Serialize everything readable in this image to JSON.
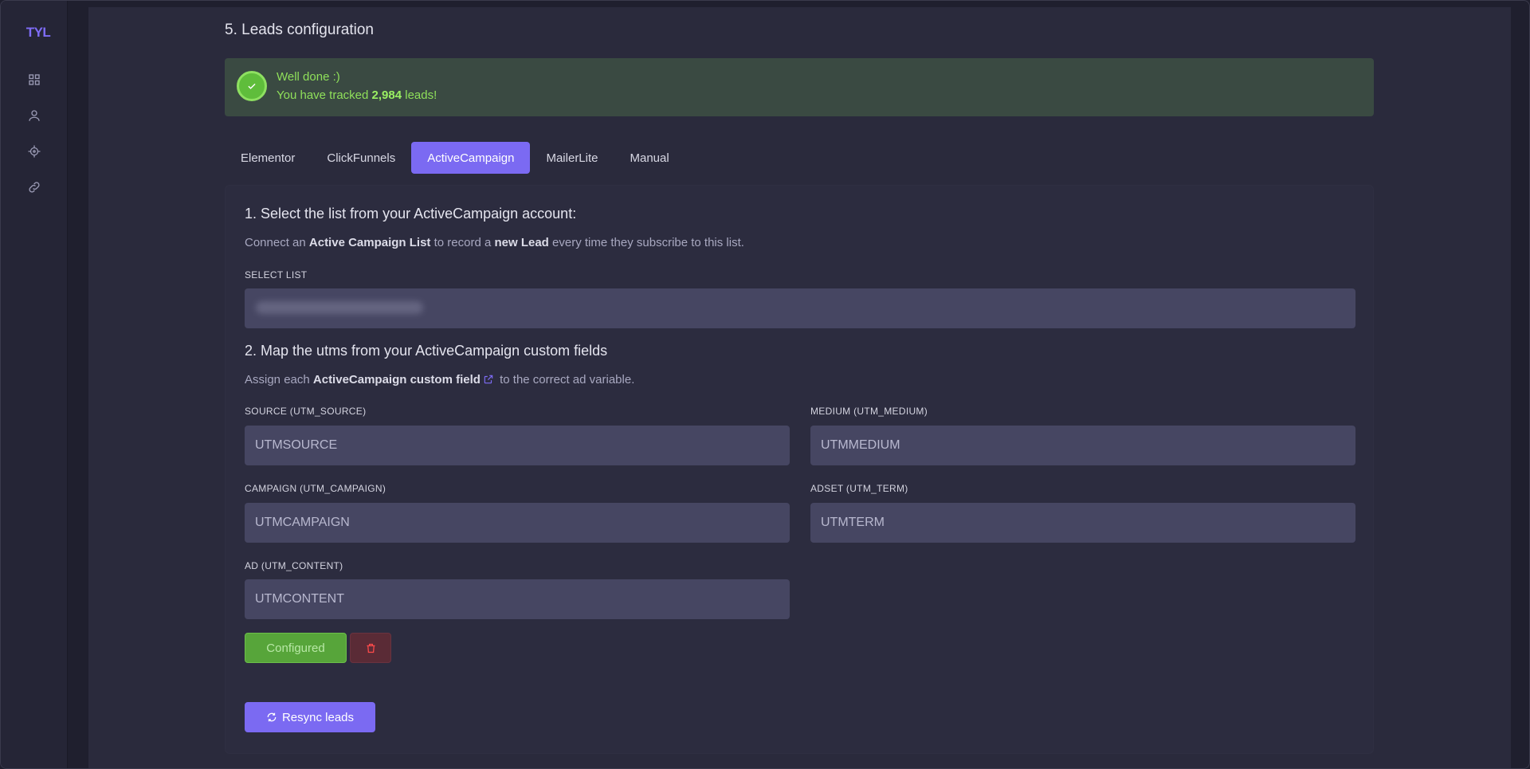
{
  "app": {
    "logo": "TYL"
  },
  "sidebar": {
    "items": [
      {
        "icon": "grid-icon"
      },
      {
        "icon": "user-icon"
      },
      {
        "icon": "target-icon"
      },
      {
        "icon": "link-icon"
      }
    ]
  },
  "section": {
    "title": "5. Leads configuration"
  },
  "alert": {
    "title": "Well done :)",
    "text_prefix": "You have tracked ",
    "count": "2,984",
    "text_suffix": " leads!"
  },
  "tabs": [
    {
      "label": "Elementor",
      "active": false
    },
    {
      "label": "ClickFunnels",
      "active": false
    },
    {
      "label": "ActiveCampaign",
      "active": true
    },
    {
      "label": "MailerLite",
      "active": false
    },
    {
      "label": "Manual",
      "active": false
    }
  ],
  "step1": {
    "heading": "1. Select the list from your ActiveCampaign account:",
    "desc_1": "Connect an ",
    "desc_b1": "Active Campaign List",
    "desc_2": " to record a ",
    "desc_b2": "new Lead",
    "desc_3": " every time they subscribe to this list.",
    "select_label": "SELECT LIST"
  },
  "step2": {
    "heading": "2. Map the utms from your ActiveCampaign custom fields",
    "desc_1": "Assign each ",
    "desc_b1": "ActiveCampaign custom field",
    "desc_2": " to the correct ad variable.",
    "fields": {
      "source": {
        "label": "SOURCE (UTM_SOURCE)",
        "value": "UTMSOURCE"
      },
      "medium": {
        "label": "MEDIUM (UTM_MEDIUM)",
        "value": "UTMMEDIUM"
      },
      "campaign": {
        "label": "CAMPAIGN (UTM_CAMPAIGN)",
        "value": "UTMCAMPAIGN"
      },
      "adset": {
        "label": "ADSET (UTM_TERM)",
        "value": "UTMTERM"
      },
      "ad": {
        "label": "AD (UTM_CONTENT)",
        "value": "UTMCONTENT"
      }
    }
  },
  "buttons": {
    "configured": "Configured",
    "resync": "Resync leads"
  },
  "colors": {
    "accent": "#7b6af2",
    "success": "#57a53a",
    "success_text": "#8fe05a",
    "danger": "#ff4b4b"
  }
}
